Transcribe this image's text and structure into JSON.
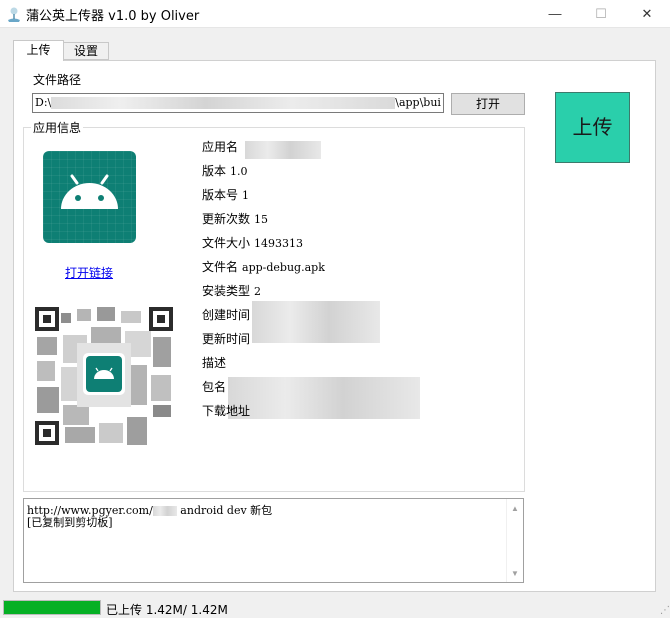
{
  "window": {
    "title": "蒲公英上传器 v1.0 by Oliver",
    "min_glyph": "—",
    "max_glyph": "☐",
    "close_glyph": "✕"
  },
  "tabs": [
    {
      "label": "上传",
      "active": true
    },
    {
      "label": "设置",
      "active": false
    }
  ],
  "file": {
    "label": "文件路径",
    "path_prefix": "D:\\",
    "path_suffix": "\\app\\bui",
    "open_button": "打开"
  },
  "upload_button": "上传",
  "app_info": {
    "group_title": "应用信息",
    "open_link": "打开链接",
    "fields": [
      {
        "label": "应用名",
        "value": ""
      },
      {
        "label": "版本",
        "value": "1.0"
      },
      {
        "label": "版本号",
        "value": "1"
      },
      {
        "label": "更新次数",
        "value": "15"
      },
      {
        "label": "文件大小",
        "value": "1493313"
      },
      {
        "label": "文件名",
        "value": "app-debug.apk"
      },
      {
        "label": "安装类型",
        "value": "2"
      },
      {
        "label": "创建时间",
        "value": ""
      },
      {
        "label": "更新时间",
        "value": ""
      },
      {
        "label": "描述",
        "value": ""
      },
      {
        "label": "包名",
        "value": ""
      },
      {
        "label": "下载地址",
        "value": ""
      }
    ]
  },
  "log": {
    "line1_prefix": "http://www.pgyer.com/",
    "line1_suffix": "android dev 新包",
    "line2": "[已复制到剪切板]"
  },
  "status": {
    "progress": 1.0,
    "text": "已上传 1.42M/ 1.42M"
  },
  "colors": {
    "upload_button": "#2acfab",
    "app_icon_bg": "#0e7f74",
    "progress_fill": "#06b025",
    "link": "#0000ee"
  },
  "icons": [
    "app-logo-icon",
    "android-icon",
    "qr-code",
    "scroll-up-icon",
    "scroll-down-icon",
    "resize-grip-icon"
  ]
}
